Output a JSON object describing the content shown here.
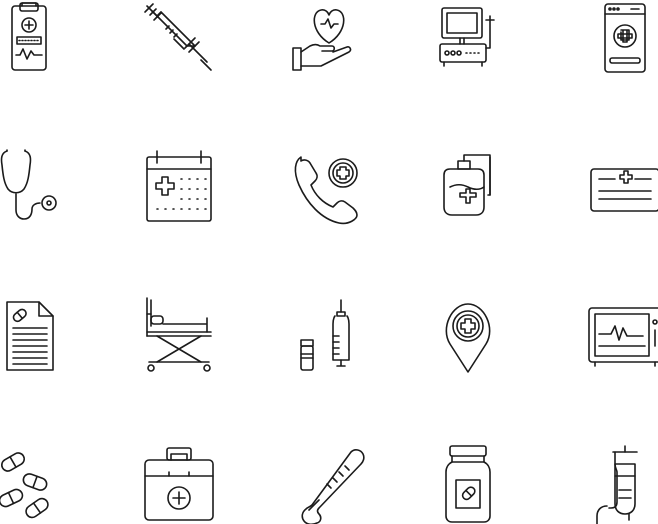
{
  "page": {
    "background": "#ffffff",
    "stroke_color": "#1b1b1b"
  },
  "icons": [
    {
      "name": "clipboard-medical-icon"
    },
    {
      "name": "syringe-icon"
    },
    {
      "name": "hand-heart-icon"
    },
    {
      "name": "medical-monitor-device-icon"
    },
    {
      "name": "medical-app-phone-icon"
    },
    {
      "name": "stethoscope-icon"
    },
    {
      "name": "medical-calendar-icon"
    },
    {
      "name": "emergency-call-icon"
    },
    {
      "name": "blood-bag-icon"
    },
    {
      "name": "health-card-icon"
    },
    {
      "name": "medical-report-icon"
    },
    {
      "name": "stretcher-icon"
    },
    {
      "name": "vaccine-vial-icon"
    },
    {
      "name": "hospital-location-pin-icon"
    },
    {
      "name": "heart-rate-monitor-icon"
    },
    {
      "name": "pills-icon"
    },
    {
      "name": "first-aid-kit-icon"
    },
    {
      "name": "thermometer-icon"
    },
    {
      "name": "medicine-jar-icon"
    },
    {
      "name": "iv-drip-icon"
    }
  ]
}
